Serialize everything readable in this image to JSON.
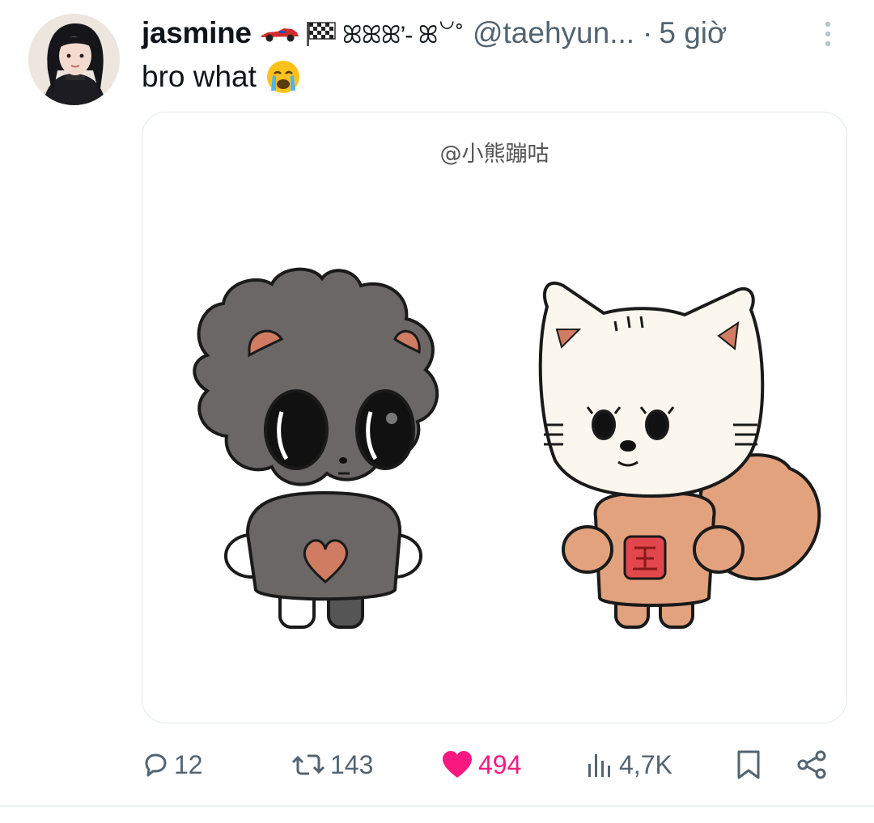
{
  "tweet": {
    "display_name": "jasmine",
    "name_decoration": "ꕤꕤꕤ’- ꕤ꒡˚",
    "handle": "@taehyun...",
    "separator": "·",
    "time": "5 giờ",
    "text": "bro what",
    "media": {
      "watermark": "@小熊蹦咕"
    }
  },
  "actions": {
    "replies": "12",
    "retweets": "143",
    "likes": "494",
    "views": "4,7K"
  },
  "icons": [
    "race-car-icon",
    "checkered-flag-icon",
    "more-options-icon",
    "crying-face-icon",
    "reply-icon",
    "retweet-icon",
    "like-icon",
    "views-icon",
    "bookmark-icon",
    "share-icon"
  ],
  "colors": {
    "like": "#f91880",
    "muted": "#536471",
    "accent": "#1d9bf0"
  }
}
